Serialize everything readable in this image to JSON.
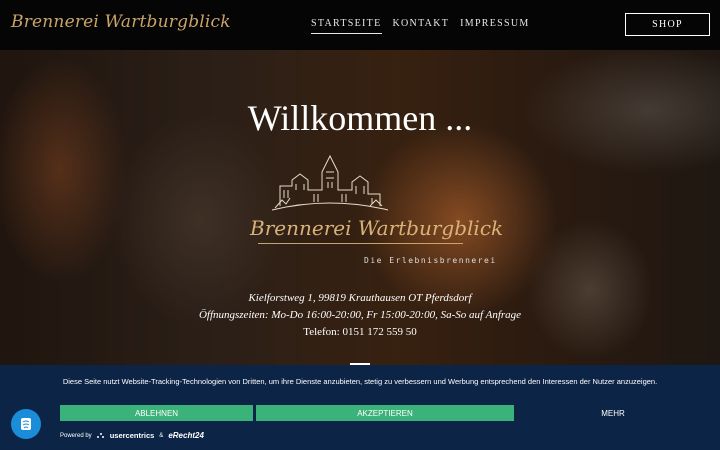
{
  "header": {
    "logo_text": "Brennerei Wartburgblick",
    "nav": [
      {
        "label": "STARTSEITE",
        "active": true
      },
      {
        "label": "KONTAKT",
        "active": false
      },
      {
        "label": "IMPRESSUM",
        "active": false
      }
    ],
    "shop_label": "SHOP"
  },
  "hero": {
    "title": "Willkommen ...",
    "brand": "Brennerei Wartburgblick",
    "subtitle": "Die Erlebnisbrennerei",
    "address": "Kielforstweg 1, 99819 Krauthausen OT Pferdsdorf",
    "hours": "Öffnungszeiten: Mo-Do 16:00-20:00, Fr 15:00-20:00, Sa-So auf Anfrage",
    "phone": "Telefon: 0151 172 559 50"
  },
  "consent": {
    "text": "Diese Seite nutzt Website-Tracking-Technologien von Dritten, um ihre Dienste anzubieten, stetig zu verbessern und Werbung entsprechend den Interessen der Nutzer anzuzeigen.",
    "deny_label": "ABLEHNEN",
    "accept_label": "AKZEPTIEREN",
    "more_label": "MEHR",
    "powered_by": "Powered by",
    "usercentrics": "usercentrics",
    "ampersand": "&",
    "erecht": "eRecht24"
  },
  "colors": {
    "brand_gold": "#c9a46a",
    "banner_bg": "#0c2546",
    "button_green": "#3bb27a",
    "fab_blue": "#1a8cd8"
  },
  "icons": {
    "castle": "castle-icon",
    "privacy": "fingerprint-icon"
  }
}
